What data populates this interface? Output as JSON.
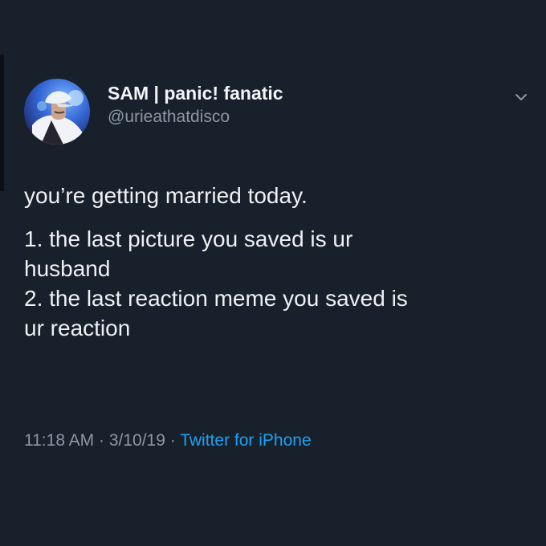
{
  "tweet": {
    "author": {
      "display_name": "SAM | panic! fanatic",
      "handle": "@urieathatdisco",
      "avatar_icon": "user-avatar",
      "menu_icon": "chevron-down-icon"
    },
    "text": {
      "line1": "you’re getting married today.",
      "item1_line1": "1. the last picture you saved is ur",
      "item1_line2": "husband",
      "item2_line1": "2. the last reaction meme you saved is",
      "item2_line2": "ur reaction"
    },
    "meta": {
      "time": "11:18 AM",
      "separator": " · ",
      "date": "3/10/19",
      "source": "Twitter for iPhone"
    }
  },
  "colors": {
    "background": "#18202b",
    "text": "#eef0f2",
    "muted": "#8b98a5",
    "link": "#1da1f2"
  }
}
